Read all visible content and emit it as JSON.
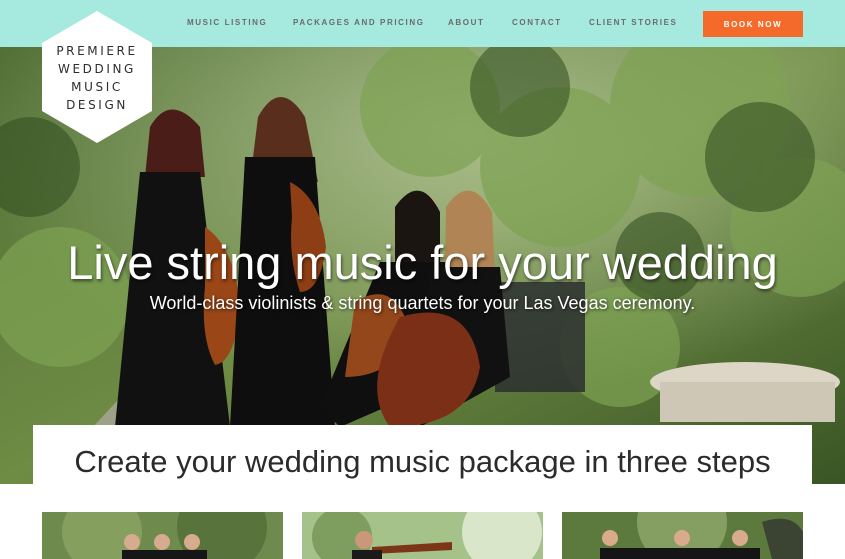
{
  "brand": {
    "logo_lines": [
      "PREMIERE",
      "WEDDING",
      "MUSIC",
      "DESIGN"
    ]
  },
  "nav": {
    "items": [
      {
        "label": "MUSIC LISTING"
      },
      {
        "label": "PACKAGES AND PRICING"
      },
      {
        "label": "ABOUT"
      },
      {
        "label": "CONTACT"
      },
      {
        "label": "CLIENT STORIES"
      }
    ],
    "cta_label": "BOOK NOW"
  },
  "hero": {
    "title": "Live string music for your wedding",
    "subtitle": "World-class violinists & string quartets for your Las Vegas ceremony."
  },
  "steps": {
    "title": "Create your wedding music package in three steps"
  },
  "colors": {
    "header_bg": "#a6e9df",
    "cta_bg": "#f46a2a",
    "text_dark": "#2b2b2b"
  },
  "icons": {
    "logo_shape": "hexagon"
  }
}
